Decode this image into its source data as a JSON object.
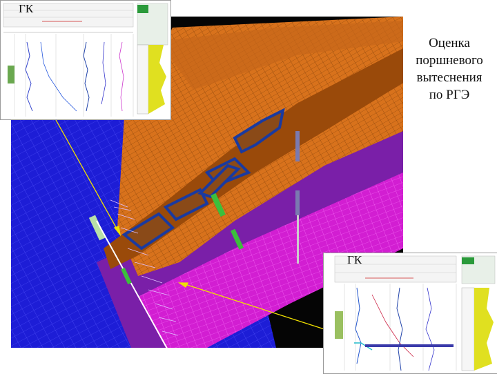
{
  "title": {
    "lines": [
      "Оценка",
      "поршневого",
      "вытеснения",
      "по РГЭ"
    ]
  },
  "insets": {
    "top_label": "ГК",
    "bottom_label": "ГК"
  },
  "colors": {
    "basement": "#1d1dd6",
    "orange_surface": "#d8721c",
    "channel": "#9a4a0a",
    "magenta": "#d21ed2",
    "purple": "#7a1fa8",
    "wells": "#3cbf3c",
    "arrow": "#f0e000"
  }
}
